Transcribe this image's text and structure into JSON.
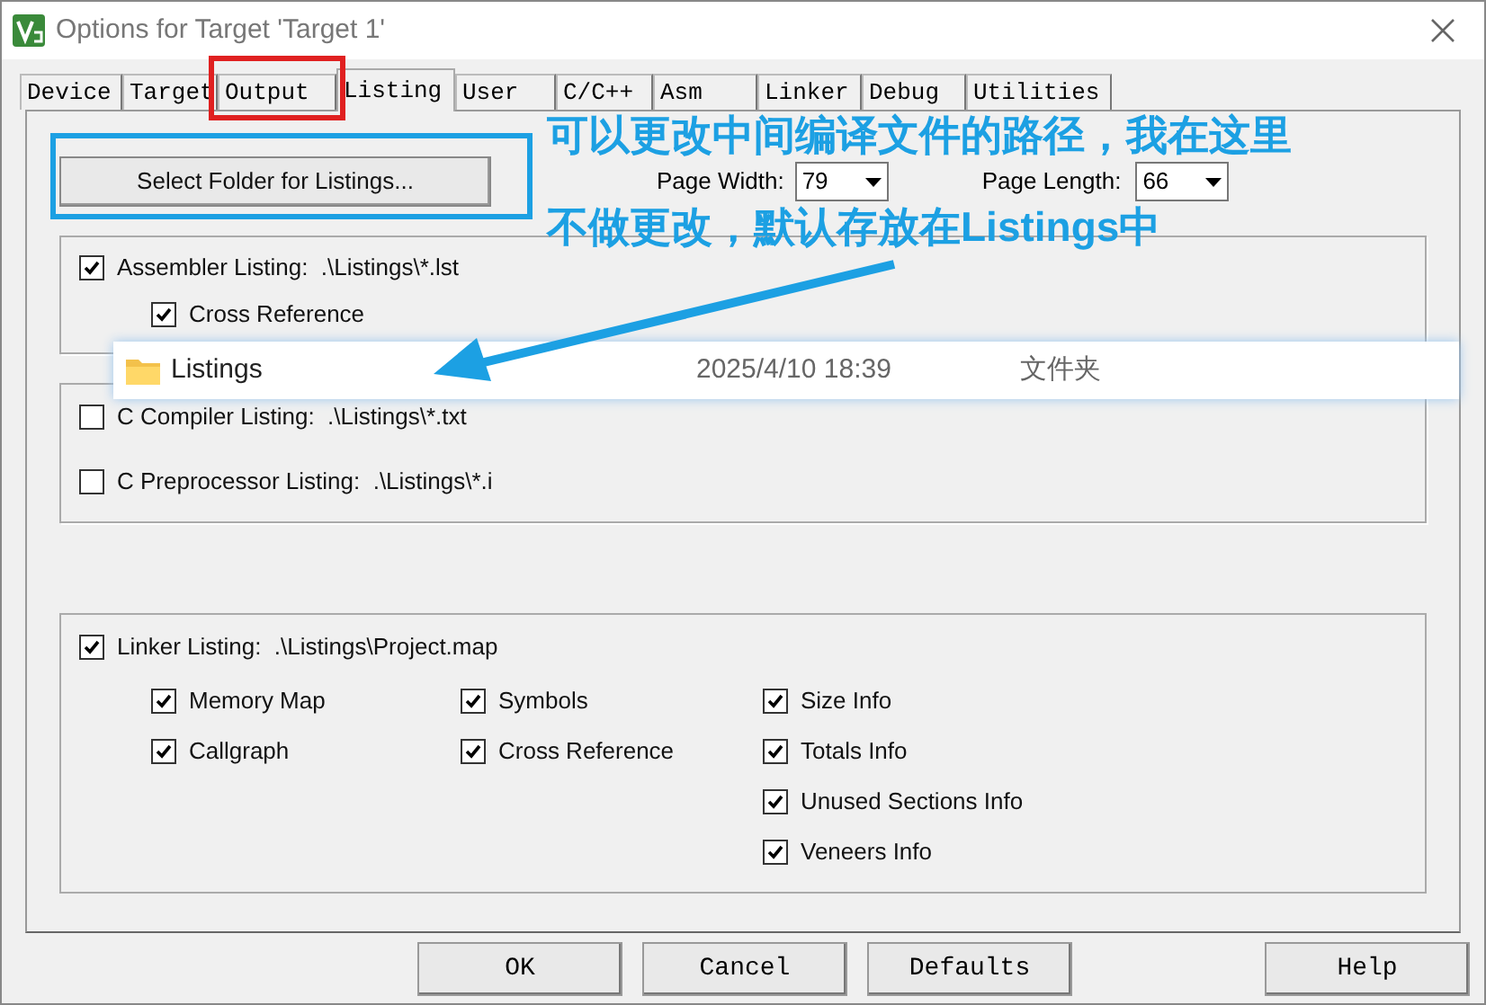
{
  "window": {
    "title": "Options for Target 'Target 1'"
  },
  "tabs": [
    {
      "label": "Device",
      "selected": false,
      "highlighted": false
    },
    {
      "label": "Target",
      "selected": false,
      "highlighted": false
    },
    {
      "label": "Output",
      "selected": false,
      "highlighted": true
    },
    {
      "label": "Listing",
      "selected": true,
      "highlighted": false
    },
    {
      "label": "User",
      "selected": false,
      "highlighted": false
    },
    {
      "label": "C/C++",
      "selected": false,
      "highlighted": false
    },
    {
      "label": "Asm",
      "selected": false,
      "highlighted": false
    },
    {
      "label": "Linker",
      "selected": false,
      "highlighted": false
    },
    {
      "label": "Debug",
      "selected": false,
      "highlighted": false
    },
    {
      "label": "Utilities",
      "selected": false,
      "highlighted": false
    }
  ],
  "select_folder_button": {
    "label": "Select Folder for Listings...",
    "highlighted": true
  },
  "page_width": {
    "label": "Page Width:",
    "value": "79"
  },
  "page_length": {
    "label": "Page Length:",
    "value": "66"
  },
  "groups": [
    {
      "items": [
        {
          "label": "Assembler Listing:  .\\Listings\\*.lst",
          "checked": true,
          "children": [
            {
              "label": "Cross Reference",
              "checked": true
            }
          ]
        }
      ]
    },
    {
      "items": [
        {
          "label": "C Compiler Listing:  .\\Listings\\*.txt",
          "checked": false
        },
        {
          "label": "C Preprocessor Listing:  .\\Listings\\*.i",
          "checked": false
        }
      ]
    }
  ],
  "linker": {
    "label": "Linker Listing:  .\\Listings\\Project.map",
    "checked": true,
    "columns": [
      [
        {
          "label": "Memory Map",
          "checked": true
        },
        {
          "label": "Callgraph",
          "checked": true
        }
      ],
      [
        {
          "label": "Symbols",
          "checked": true
        },
        {
          "label": "Cross Reference",
          "checked": true
        }
      ],
      [
        {
          "label": "Size Info",
          "checked": true
        },
        {
          "label": "Totals Info",
          "checked": true
        },
        {
          "label": "Unused Sections Info",
          "checked": true
        },
        {
          "label": "Veneers Info",
          "checked": true
        }
      ]
    ]
  },
  "annotation": {
    "lines": [
      "可以更改中间编译文件的路径，我在这里",
      "不做更改，默认存放在Listings中"
    ]
  },
  "explorer_row": {
    "name": "Listings",
    "date": "2025/4/10 18:39",
    "type": "文件夹"
  },
  "buttons": [
    {
      "label": "OK",
      "kind": "center"
    },
    {
      "label": "Cancel",
      "kind": "center"
    },
    {
      "label": "Defaults",
      "kind": "center"
    },
    {
      "label": "Help",
      "kind": "right"
    }
  ]
}
